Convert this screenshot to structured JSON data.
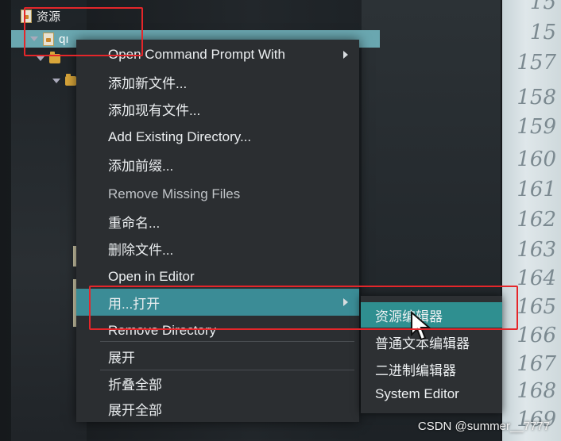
{
  "tree": {
    "root_label": "资源",
    "child_label": "qı",
    "colors": {
      "selection": "#6aa7b0",
      "folder": "#d9a63a"
    }
  },
  "context_menu": {
    "items": [
      {
        "label": "Open Command Prompt With",
        "submenu": true
      },
      {
        "label": "添加新文件..."
      },
      {
        "label": "添加现有文件..."
      },
      {
        "label": "Add Existing Directory..."
      },
      {
        "label": "添加前缀..."
      },
      {
        "label": "Remove Missing Files"
      },
      {
        "label": "重命名..."
      },
      {
        "label": "删除文件..."
      },
      {
        "label": "Open in Editor"
      },
      {
        "label": "用...打开",
        "submenu": true,
        "highlighted": true
      },
      {
        "label": "Remove Directory"
      },
      {
        "label": "展开"
      },
      {
        "label": "折叠全部"
      },
      {
        "label": "展开全部"
      }
    ],
    "highlight_color": "#3b8c96"
  },
  "open_with_submenu": {
    "items": [
      {
        "label": "资源编辑器",
        "highlighted": true
      },
      {
        "label": "普通文本编辑器"
      },
      {
        "label": "二进制编辑器"
      },
      {
        "label": "System Editor"
      }
    ],
    "highlight_color": "#2f8f90"
  },
  "line_numbers": [
    "15",
    "15",
    "157",
    "158",
    "159",
    "160",
    "161",
    "162",
    "163",
    "164",
    "165",
    "166",
    "167",
    "168",
    "169"
  ],
  "annotation_color": "#e5262a",
  "watermark": "CSDN @summer__7777",
  "icons": [
    "expander-icon",
    "folder-icon",
    "lock-file-icon",
    "submenu-arrow-icon",
    "mouse-cursor-icon"
  ]
}
